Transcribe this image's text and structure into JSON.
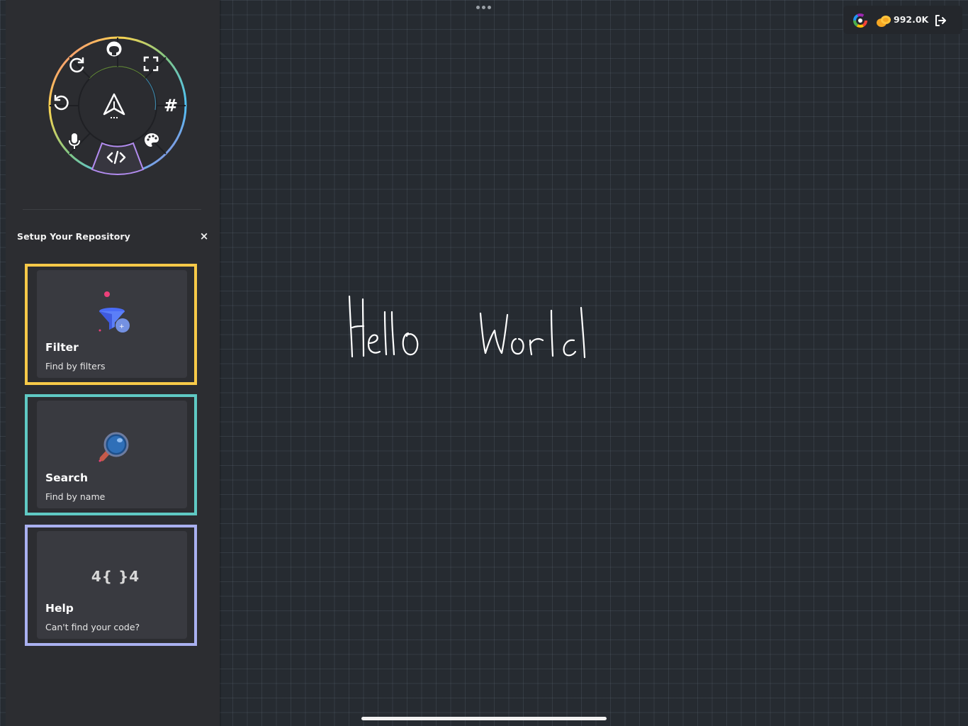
{
  "sidebar": {
    "radial_menu": {
      "center_icon": "send-paper-plane-icon",
      "items": [
        {
          "name": "github-icon"
        },
        {
          "name": "fullscreen-icon"
        },
        {
          "name": "hashtag-icon"
        },
        {
          "name": "palette-icon"
        },
        {
          "name": "code-icon"
        },
        {
          "name": "microphone-icon"
        },
        {
          "name": "undo-icon"
        },
        {
          "name": "redo-icon"
        }
      ],
      "selected": "code-icon"
    },
    "setup": {
      "title": "Setup Your Repository",
      "close_label": "×"
    },
    "cards": [
      {
        "title": "Filter",
        "subtitle": "Find by filters",
        "border_color": "#f7c948",
        "icon": "funnel-icon"
      },
      {
        "title": "Search",
        "subtitle": "Find by name",
        "border_color": "#5fc9c3",
        "icon": "magnifier-icon"
      },
      {
        "title": "Help",
        "subtitle": "Can't find your code?",
        "border_color": "#a9b0f0",
        "icon": "404-icon",
        "icon_text": "4{ }4"
      }
    ]
  },
  "topbar": {
    "coins": "992.0K",
    "icons": [
      "color-wheel-icon",
      "coins-icon",
      "logout-icon"
    ]
  },
  "canvas": {
    "handwriting": "Hello World"
  },
  "colors": {
    "canvas_bg": "#262b31",
    "sidebar_bg": "#2c2d31",
    "card_bg": "#393a40"
  }
}
